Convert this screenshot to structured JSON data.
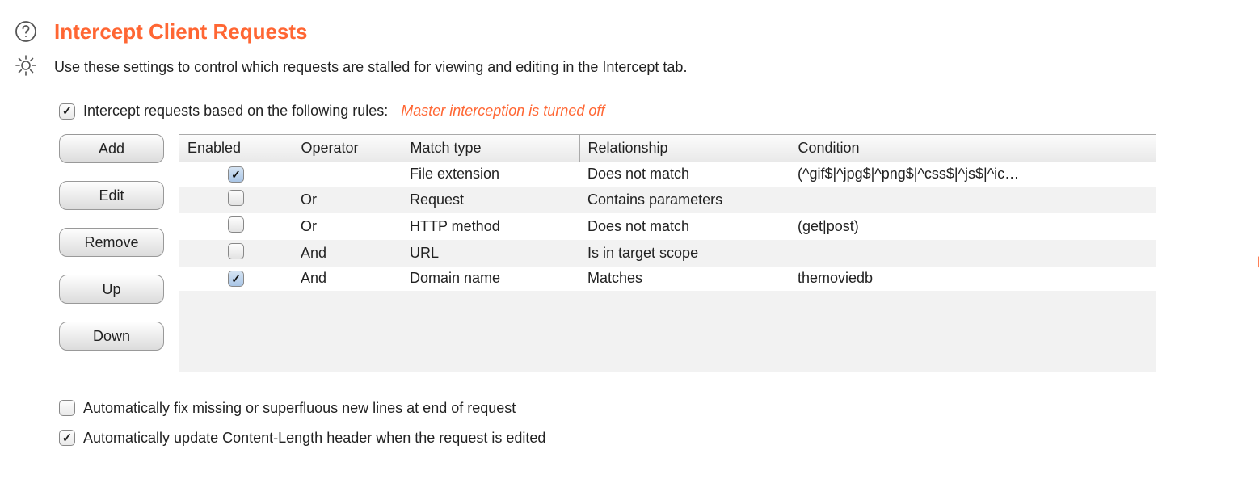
{
  "header": {
    "title": "Intercept Client Requests",
    "description": "Use these settings to control which requests are stalled for viewing and editing in the Intercept tab."
  },
  "intercept": {
    "enable_checked": true,
    "enable_label": "Intercept requests based on the following rules:",
    "warning": "Master interception is turned off"
  },
  "buttons": {
    "add": "Add",
    "edit": "Edit",
    "remove": "Remove",
    "up": "Up",
    "down": "Down"
  },
  "table": {
    "headers": {
      "enabled": "Enabled",
      "operator": "Operator",
      "match_type": "Match type",
      "relationship": "Relationship",
      "condition": "Condition"
    },
    "rows": [
      {
        "enabled": true,
        "operator": "",
        "match_type": "File extension",
        "relationship": "Does not match",
        "condition": "(^gif$|^jpg$|^png$|^css$|^js$|^ic…"
      },
      {
        "enabled": false,
        "operator": "Or",
        "match_type": "Request",
        "relationship": "Contains parameters",
        "condition": ""
      },
      {
        "enabled": false,
        "operator": "Or",
        "match_type": "HTTP method",
        "relationship": "Does not match",
        "condition": "(get|post)"
      },
      {
        "enabled": false,
        "operator": "And",
        "match_type": "URL",
        "relationship": "Is in target scope",
        "condition": ""
      },
      {
        "enabled": true,
        "operator": "And",
        "match_type": "Domain name",
        "relationship": "Matches",
        "condition": "themoviedb"
      }
    ]
  },
  "footer": {
    "fix_newlines_checked": false,
    "fix_newlines": "Automatically fix missing or superfluous new lines at end of request",
    "update_cl_checked": true,
    "update_cl": "Automatically update Content-Length header when the request is edited"
  }
}
